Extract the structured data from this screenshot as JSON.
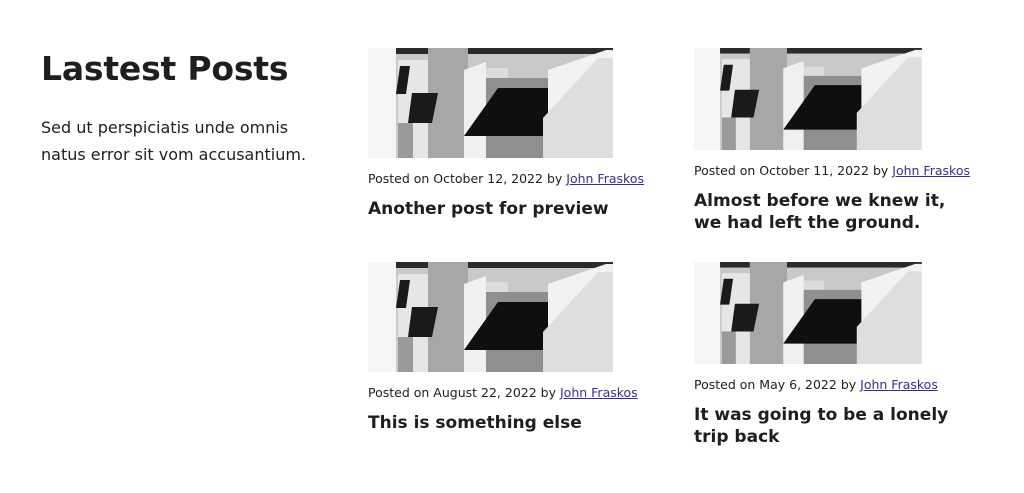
{
  "intro": {
    "heading": "Lastest Posts",
    "description": "Sed ut perspiciatis unde omnis natus error sit vom accusantium."
  },
  "posts": [
    {
      "posted_on": "Posted on October 12, 2022",
      "by": "by",
      "author": "John Fraskos",
      "title": "Another post for preview"
    },
    {
      "posted_on": "Posted on October 11, 2022",
      "by": "by",
      "author": "John Fraskos",
      "title": "Almost before we knew it, we had left the ground."
    },
    {
      "posted_on": "Posted on August 22, 2022",
      "by": "by",
      "author": "John Fraskos",
      "title": "This is something else"
    },
    {
      "posted_on": "Posted on May 6, 2022",
      "by": "by",
      "author": "John Fraskos",
      "title": "It was going to be a lonely trip back"
    }
  ],
  "colors": {
    "text": "#1e1e1e",
    "link": "#3b2d8f",
    "background": "#ffffff"
  }
}
